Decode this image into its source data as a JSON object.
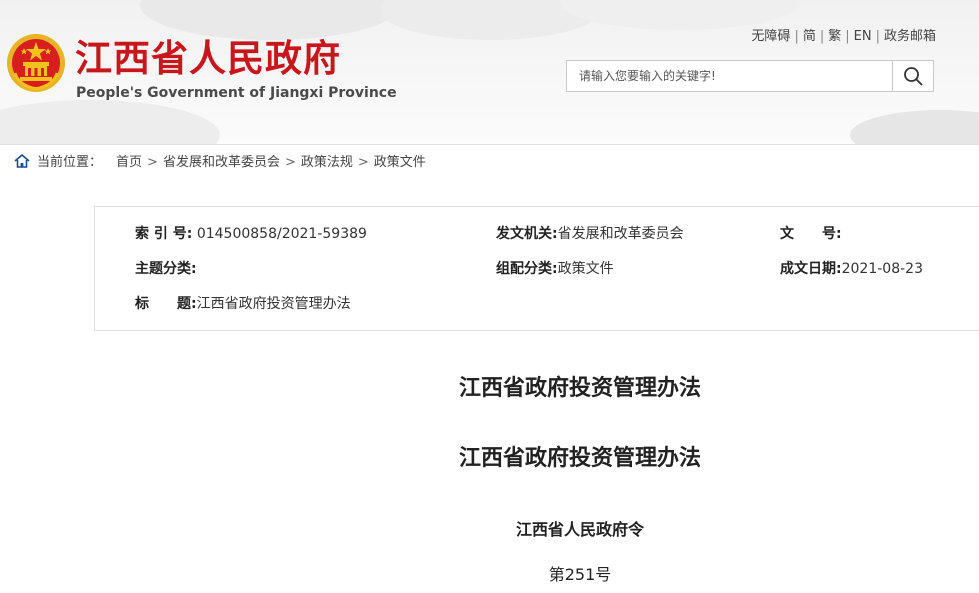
{
  "header": {
    "title_cn": "江西省人民政府",
    "title_en": "People's Government of Jiangxi Province",
    "top_links": [
      "无障碍",
      "简",
      "繁",
      "EN",
      "政务邮箱"
    ],
    "search": {
      "placeholder": "请输入您要输入的关键字!"
    }
  },
  "colors": {
    "brand_red": "#c8161d",
    "emblem_gold": "#e8b425"
  },
  "icons": {
    "emblem": "national-emblem-icon",
    "search": "search-icon",
    "home": "home-icon"
  },
  "breadcrumb": {
    "label": "当前位置：",
    "items": [
      "首页",
      "省发展和改革委员会",
      "政策法规",
      "政策文件"
    ]
  },
  "meta": {
    "index_label": "索 引 号:",
    "index_value": "014500858/2021-59389",
    "issuer_label": "发文机关:",
    "issuer_value": "省发展和改革委员会",
    "docno_label": "文　　号:",
    "docno_value": "",
    "topic_label": "主题分类:",
    "topic_value": "",
    "category_label": "组配分类:",
    "category_value": "政策文件",
    "date_label": "成文日期:",
    "date_value": "2021-08-23",
    "title_label": "标　　题:",
    "title_value": "江西省政府投资管理办法"
  },
  "document": {
    "title": "江西省政府投资管理办法",
    "title_repeat": "江西省政府投资管理办法",
    "decree": "江西省人民政府令",
    "number": "第251号"
  }
}
